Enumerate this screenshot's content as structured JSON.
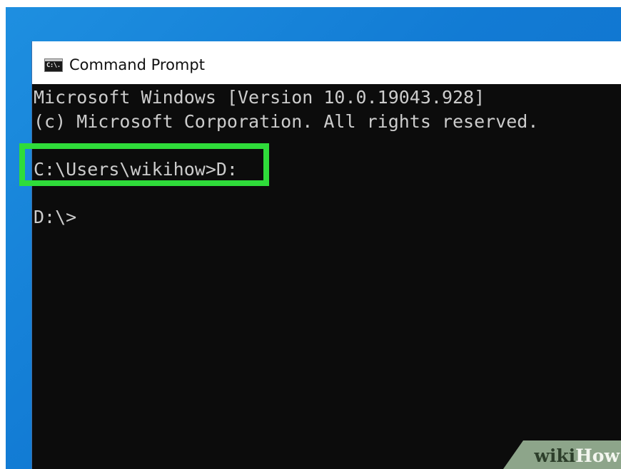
{
  "window": {
    "title": "Command Prompt",
    "icon": "cmd-icon",
    "icon_glyph": "C:\\."
  },
  "console": {
    "lines": [
      "Microsoft Windows [Version 10.0.19043.928]",
      "(c) Microsoft Corporation. All rights reserved.",
      "",
      "C:\\Users\\wikihow>D:",
      "",
      "D:\\>"
    ],
    "text_color": "#cccccc",
    "background_color": "#0c0c0c"
  },
  "highlight": {
    "color": "#2fdc3a"
  },
  "watermark": {
    "part1": "wiki",
    "part2": "How"
  }
}
